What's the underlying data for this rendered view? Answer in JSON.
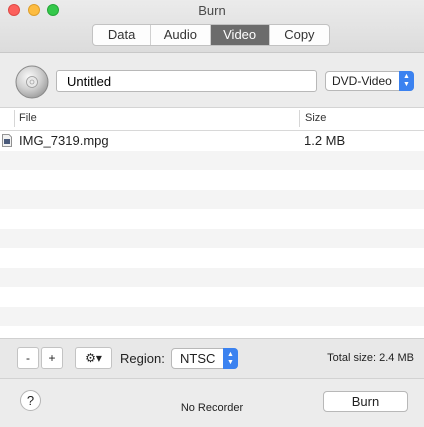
{
  "window": {
    "title": "Burn"
  },
  "tabs": [
    {
      "label": "Data",
      "active": false
    },
    {
      "label": "Audio",
      "active": false
    },
    {
      "label": "Video",
      "active": true
    },
    {
      "label": "Copy",
      "active": false
    }
  ],
  "disc": {
    "name_value": "Untitled",
    "format_selected": "DVD-Video"
  },
  "table": {
    "columns": [
      "File",
      "Size"
    ],
    "rows": [
      {
        "file": "IMG_7319.mpg",
        "size": "1.2 MB"
      }
    ]
  },
  "toolbar": {
    "remove_label": "-",
    "add_label": "+",
    "gear_icon": "gear-icon",
    "region_label": "Region:",
    "region_selected": "NTSC",
    "total_size": "Total size: 2.4 MB"
  },
  "footer": {
    "help_label": "?",
    "recorder_status": "No Recorder",
    "burn_label": "Burn"
  },
  "colors": {
    "active_tab": "#6c6c6c",
    "select_accent": "#3b82f0"
  }
}
